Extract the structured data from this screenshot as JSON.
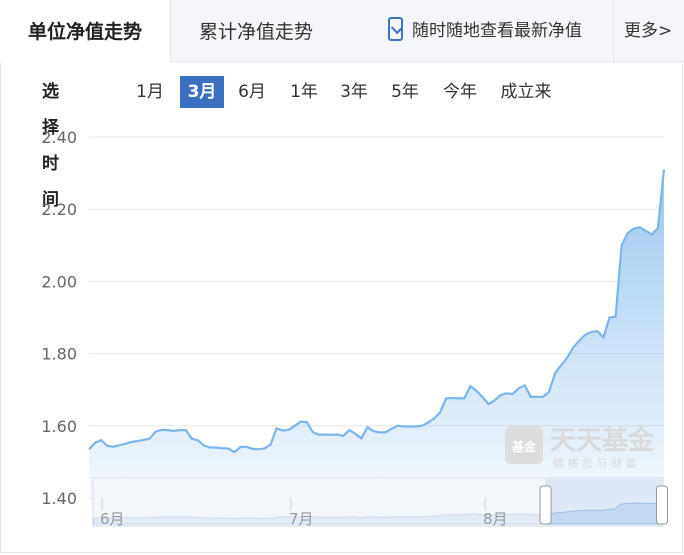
{
  "tabs": [
    {
      "label": "单位净值走势",
      "active": true
    },
    {
      "label": "累计净值走势",
      "active": false
    }
  ],
  "promo": {
    "text": "随时随地查看最新净值",
    "icon": "mobile-phone-icon"
  },
  "more": {
    "label": "更多>"
  },
  "range_selector": {
    "label": "选择时间",
    "options": [
      "1月",
      "3月",
      "6月",
      "1年",
      "3年",
      "5年",
      "今年",
      "成立来"
    ],
    "selected": "3月"
  },
  "watermark": {
    "brand": "天天基金",
    "slogan": "链 接 您 与 财 富",
    "badge": "基金"
  },
  "navigator": {
    "labels": [
      "6月",
      "7月",
      "8月"
    ],
    "window": [
      0.795,
      1.0
    ]
  },
  "colors": {
    "line": "#7cb5ec",
    "accent": "#3b6fbf"
  },
  "chart_data": {
    "type": "area",
    "ylim": [
      1.4,
      2.4
    ],
    "yticks": [
      "2.40",
      "2.20",
      "2.00",
      "1.80",
      "1.60",
      "1.40"
    ],
    "grid": true,
    "x_month_labels": [
      "6月",
      "7月",
      "8月"
    ],
    "y": [
      1.535,
      1.553,
      1.56,
      1.545,
      1.542,
      1.546,
      1.55,
      1.555,
      1.558,
      1.561,
      1.564,
      1.584,
      1.589,
      1.588,
      1.586,
      1.588,
      1.588,
      1.564,
      1.56,
      1.545,
      1.54,
      1.54,
      1.538,
      1.537,
      1.527,
      1.541,
      1.542,
      1.536,
      1.535,
      1.537,
      1.548,
      1.593,
      1.587,
      1.589,
      1.6,
      1.612,
      1.61,
      1.582,
      1.575,
      1.576,
      1.575,
      1.576,
      1.572,
      1.588,
      1.578,
      1.565,
      1.596,
      1.585,
      1.582,
      1.582,
      1.592,
      1.6,
      1.598,
      1.598,
      1.598,
      1.6,
      1.609,
      1.62,
      1.637,
      1.676,
      1.677,
      1.676,
      1.676,
      1.71,
      1.697,
      1.68,
      1.66,
      1.67,
      1.685,
      1.69,
      1.688,
      1.704,
      1.712,
      1.68,
      1.68,
      1.68,
      1.694,
      1.746,
      1.768,
      1.789,
      1.817,
      1.836,
      1.852,
      1.86,
      1.862,
      1.845,
      1.9,
      1.902,
      2.1,
      2.134,
      2.146,
      2.15,
      2.14,
      2.13,
      2.148,
      2.31
    ]
  }
}
